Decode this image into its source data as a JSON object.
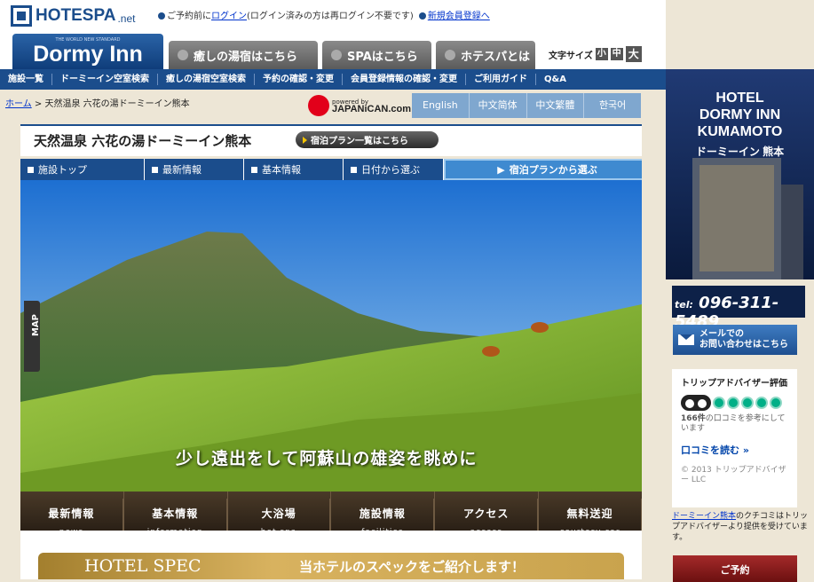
{
  "header": {
    "logo": "HOTESPA",
    "logo_suffix": ".net",
    "notice_prefix": "ご予約前に",
    "login_link": "ログイン",
    "notice_suffix": "(ログイン済みの方は再ログイン不要です)",
    "register_link": "新規会員登録へ"
  },
  "brand_tab": {
    "sub": "THE WORLD NEW STANDARD",
    "name": "Dormy Inn"
  },
  "tabs": [
    {
      "label": "癒しの湯宿はこちら"
    },
    {
      "label": "SPAはこちら"
    },
    {
      "label": "ホテスパとは"
    }
  ],
  "font_size": {
    "label": "文字サイズ",
    "small": "小",
    "medium": "中",
    "large": "大"
  },
  "main_nav": [
    "施設一覧",
    "ドーミーイン空室検索",
    "癒しの湯宿空室検索",
    "予約の確認・変更",
    "会員登録情報の確認・変更",
    "ご利用ガイド",
    "Q&A"
  ],
  "breadcrumb": {
    "home": "ホーム",
    "sep": ">",
    "current": "天然温泉 六花の湯ドーミーイン熊本"
  },
  "japanican": {
    "powered": "powered by",
    "name": "JAPANiCAN.com"
  },
  "languages": [
    "English",
    "中文简体",
    "中文繁體",
    "한국어"
  ],
  "hotel_title": "天然温泉 六花の湯ドーミーイン熊本",
  "plan_button": "宿泊プラン一覧はこちら",
  "sub_nav": [
    "施設トップ",
    "最新情報",
    "基本情報",
    "日付から選ぶ",
    "宿泊プランから選ぶ"
  ],
  "hero": {
    "caption": "少し遠出をして阿蘇山の雄姿を眺めに",
    "map_tab": "MAP"
  },
  "bottom_nav": [
    {
      "jp": "最新情報",
      "en": "news"
    },
    {
      "jp": "基本情報",
      "en": "information"
    },
    {
      "jp": "大浴場",
      "en": "hot spa"
    },
    {
      "jp": "施設情報",
      "en": "facilities"
    },
    {
      "jp": "アクセス",
      "en": "access"
    },
    {
      "jp": "無料送迎",
      "en": "courtesy car"
    }
  ],
  "spec": {
    "title": "HOTEL SPEC",
    "desc": "当ホテルのスペックをご紹介します！"
  },
  "sidebar": {
    "hotel_line1": "HOTEL",
    "hotel_line2": "DORMY INN",
    "hotel_line3": "KUMAMOTO",
    "hotel_jp": "ドーミーイン 熊本",
    "tel_label": "tel:",
    "tel": "096-311-5489",
    "mail_line1": "メールでの",
    "mail_line2": "お問い合わせはこちら",
    "ta_title": "トリップアドバイザー評価",
    "ta_count": "166件",
    "ta_count_suffix": "の口コミを参考にしています",
    "ta_link": "口コミを読む »",
    "ta_copy": "© 2013 トリップアドバイザー LLC",
    "note_link": "ドーミーイン熊本",
    "note_text": "のクチコミはトリップアドバイザーより提供を受けています。",
    "reserve": "ご予約"
  }
}
